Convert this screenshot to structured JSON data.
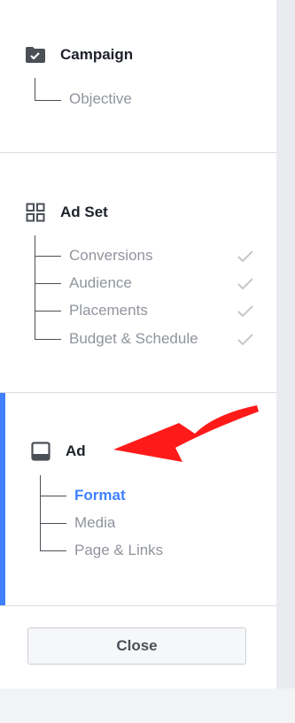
{
  "campaign": {
    "title": "Campaign",
    "icon": "folder-check-icon",
    "items": [
      {
        "label": "Objective"
      }
    ]
  },
  "adset": {
    "title": "Ad Set",
    "icon": "grid-icon",
    "items": [
      {
        "label": "Conversions",
        "completed": true
      },
      {
        "label": "Audience",
        "completed": true
      },
      {
        "label": "Placements",
        "completed": true
      },
      {
        "label": "Budget & Schedule",
        "completed": true
      }
    ]
  },
  "ad": {
    "title": "Ad",
    "icon": "ad-preview-icon",
    "items": [
      {
        "label": "Format",
        "active": true
      },
      {
        "label": "Media"
      },
      {
        "label": "Page & Links"
      }
    ]
  },
  "footer": {
    "close_label": "Close"
  },
  "colors": {
    "accent": "#4080ff",
    "annotation_arrow": "#ff1a1a",
    "muted_text": "#90949c",
    "heading_text": "#1d2129"
  }
}
